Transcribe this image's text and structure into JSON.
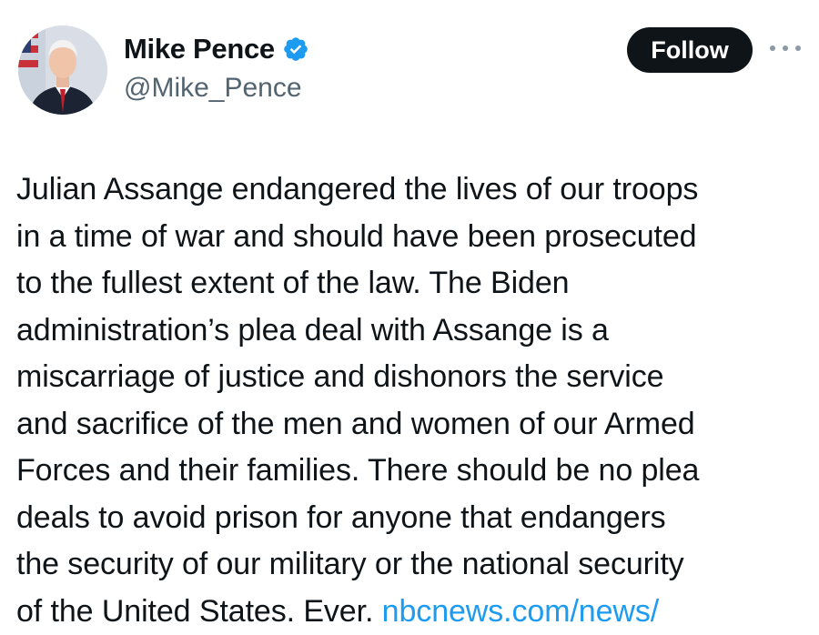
{
  "profile": {
    "display_name": "Mike Pence",
    "handle": "@Mike_Pence",
    "verified": true,
    "avatar_icon": "profile-photo"
  },
  "actions": {
    "follow_label": "Follow",
    "more_icon": "more-options-icon"
  },
  "tweet": {
    "lines": [
      "Julian Assange endangered the lives of our troops",
      "in a time of war and should have been prosecuted",
      "to the fullest extent of the law. The Biden",
      "administration’s plea deal with Assange is a",
      "miscarriage of justice and dishonors the service",
      "and sacrifice of the men and women of our Armed",
      "Forces and their families. There should be no plea",
      "deals to avoid prison for anyone that endangers",
      "the security of our military or the national security",
      "of the United States. Ever."
    ],
    "link_text": "nbcnews.com/news/"
  },
  "colors": {
    "link": "#1d9bf0",
    "verified_badge": "#1d9bf0",
    "follow_bg": "#0f1419",
    "secondary_text": "#536471"
  }
}
